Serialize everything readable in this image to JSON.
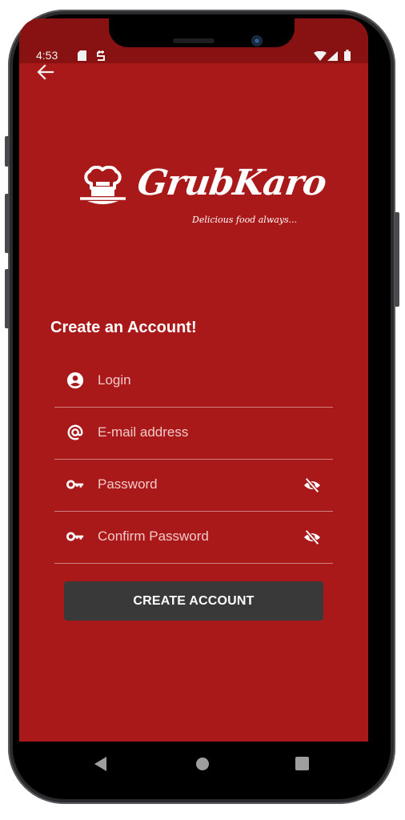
{
  "status_bar": {
    "time": "4:53",
    "left_icons": [
      "sd-card-icon",
      "sim-icon"
    ],
    "right_icons": [
      "wifi-icon",
      "signal-icon",
      "battery-icon"
    ]
  },
  "top_bar": {
    "back_icon": "arrow-left-icon"
  },
  "brand": {
    "name": "GrubKaro",
    "tagline": "Delicious food always...",
    "logo_icon": "chef-hat-icon"
  },
  "form": {
    "title": "Create an Account!",
    "fields": [
      {
        "icon": "account-circle-icon",
        "placeholder": "Login",
        "value": "",
        "type": "text"
      },
      {
        "icon": "at-sign-icon",
        "placeholder": "E-mail address",
        "value": "",
        "type": "email"
      },
      {
        "icon": "key-icon",
        "placeholder": "Password",
        "value": "",
        "type": "password",
        "toggle_icon": "eye-off-icon"
      },
      {
        "icon": "key-icon",
        "placeholder": "Confirm Password",
        "value": "",
        "type": "password",
        "toggle_icon": "eye-off-icon"
      }
    ],
    "submit_label": "CREATE ACCOUNT"
  },
  "nav_bar": {
    "buttons": [
      "back-triangle-icon",
      "home-circle-icon",
      "recents-square-icon"
    ]
  },
  "colors": {
    "background": "#aa1919",
    "status_bar": "#881111",
    "button": "#393939",
    "text": "#ffffff"
  }
}
